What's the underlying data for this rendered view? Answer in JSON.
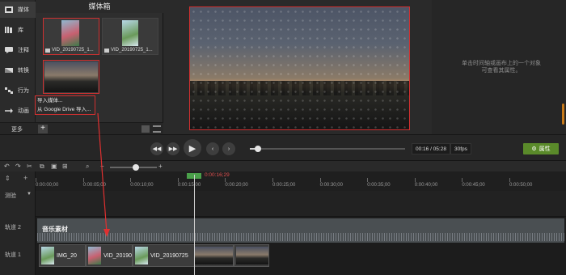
{
  "sidebar": {
    "items": [
      {
        "label": "媒体",
        "icon": "film-icon"
      },
      {
        "label": "库",
        "icon": "library-icon"
      },
      {
        "label": "注释",
        "icon": "annotation-icon"
      },
      {
        "label": "转换",
        "icon": "transition-icon"
      },
      {
        "label": "行为",
        "icon": "behavior-icon"
      },
      {
        "label": "动画",
        "icon": "animation-icon"
      }
    ],
    "more_label": "更多"
  },
  "media_bin": {
    "title": "媒体箱",
    "items": [
      {
        "caption": "VID_20190725_1...",
        "selected": true
      },
      {
        "caption": "VID_20190725_1...",
        "selected": false
      },
      {
        "caption": "",
        "selected": false
      }
    ]
  },
  "context_menu": {
    "items": [
      "导入媒体...",
      "从 Google Drive 导入..."
    ]
  },
  "properties_panel": {
    "hint_line1": "单击时间轴或画布上的一个对象",
    "hint_line2": "可查看其属性。",
    "button_label": "属性"
  },
  "playback": {
    "time_display": "00:16 / 05:28",
    "fps": "30fps",
    "progress": 0.05
  },
  "timeline": {
    "playhead_time": "0:00:16;29",
    "zoom_level": 0.55,
    "ruler_ticks": [
      "0:00:00;00",
      "0:00:05;00",
      "0:00:10;00",
      "0:00:15;00",
      "0:00:20;00",
      "0:00:25;00",
      "0:00:30;00",
      "0:00:35;00",
      "0:00:40;00",
      "0:00:45;00",
      "0:00:50;00"
    ],
    "header_label": "测验",
    "tracks": [
      {
        "label": "轨道 2",
        "clip_label": "音乐素材"
      },
      {
        "label": "轨道 1",
        "clips": [
          "IMG_20",
          "VID_20190",
          "VID_20190725"
        ]
      }
    ]
  },
  "colors": {
    "highlight_red": "#d03030",
    "properties_green": "#5a8a2a",
    "playhead_green": "#4aa04a"
  }
}
